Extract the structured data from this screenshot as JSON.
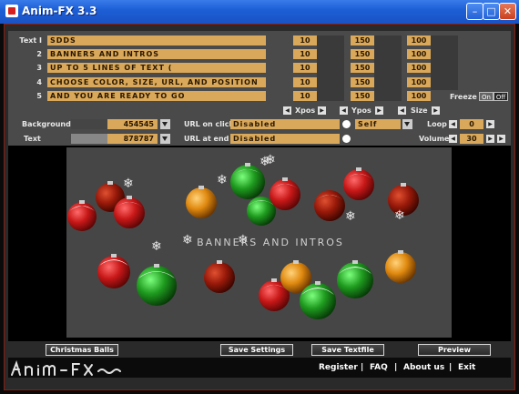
{
  "window": {
    "title": "Anim-FX 3.3"
  },
  "text_rows": [
    {
      "label": "Text I",
      "text": "SDDS",
      "x": "10",
      "y": "150",
      "size": "100"
    },
    {
      "label": "2",
      "text": "BANNERS AND INTROS",
      "x": "10",
      "y": "150",
      "size": "100"
    },
    {
      "label": "3",
      "text": "UP TO 5 LINES OF TEXT (",
      "x": "10",
      "y": "150",
      "size": "100"
    },
    {
      "label": "4",
      "text": "CHOOSE COLOR, SIZE, URL, AND POSITION",
      "x": "10",
      "y": "150",
      "size": "100"
    },
    {
      "label": "5",
      "text": "AND YOU ARE READY TO GO",
      "x": "10",
      "y": "150",
      "size": "100"
    }
  ],
  "freeze": {
    "label": "Freeze",
    "on": "On",
    "off": "Off"
  },
  "axis_controls": {
    "xpos": "Xpos",
    "ypos": "Ypos",
    "size": "Size"
  },
  "background": {
    "label": "Background",
    "value": "454545",
    "swatch": "#454545"
  },
  "text_color": {
    "label": "Text",
    "value": "878787",
    "swatch": "#878787"
  },
  "url_click": {
    "label": "URL on click",
    "value": "Disabled",
    "target": "Self"
  },
  "url_end": {
    "label": "URL at end",
    "value": "Disabled"
  },
  "loop": {
    "label": "Loop",
    "value": "0"
  },
  "volume": {
    "label": "Volume",
    "value": "30"
  },
  "preview_text": "BANNERS AND INTROS",
  "buttons": {
    "effect": "Christmas Balls",
    "save_settings": "Save Settings",
    "save_textfile": "Save Textfile",
    "preview": "Preview"
  },
  "links": {
    "register": "Register",
    "faq": "FAQ",
    "about": "About us",
    "exit": "Exit",
    "sep": "|"
  },
  "logo": "Anim-FX",
  "colors": {
    "accent": "#d9a85a",
    "frame": "#8a1d10",
    "title_blue": "#1d5fd6"
  }
}
